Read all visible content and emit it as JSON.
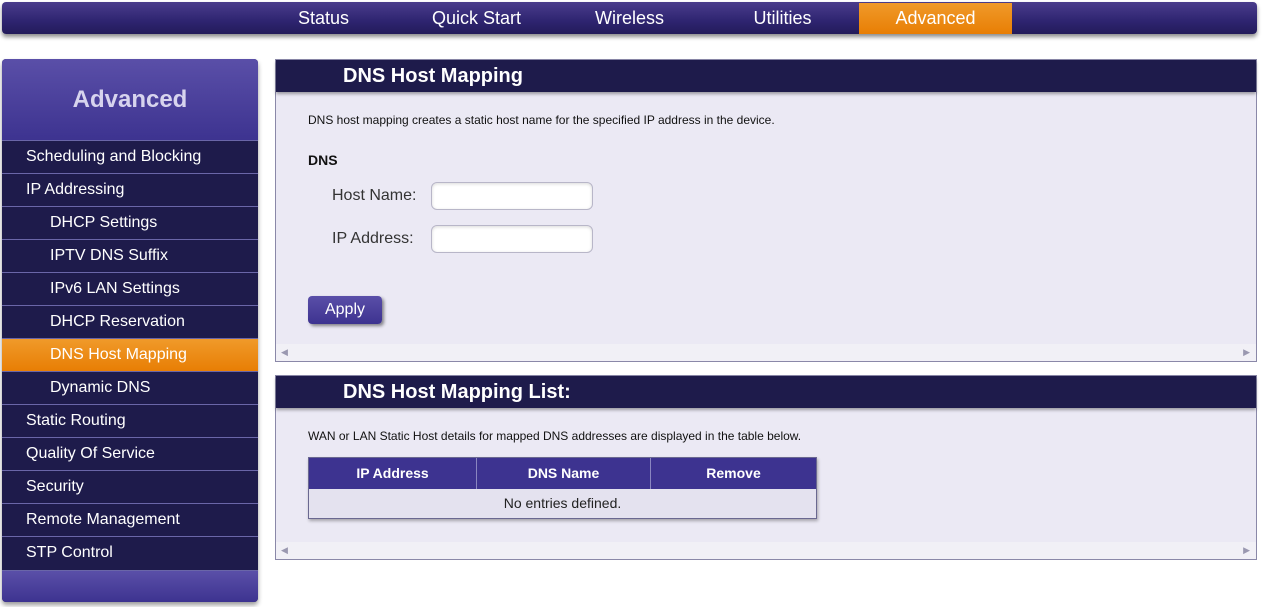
{
  "topnav": {
    "tabs": [
      {
        "label": "Status"
      },
      {
        "label": "Quick Start"
      },
      {
        "label": "Wireless"
      },
      {
        "label": "Utilities"
      },
      {
        "label": "Advanced",
        "active": true
      }
    ]
  },
  "sidebar": {
    "title": "Advanced",
    "items": [
      {
        "label": "Scheduling and Blocking"
      },
      {
        "label": "IP Addressing"
      },
      {
        "label": "DHCP Settings"
      },
      {
        "label": "IPTV DNS Suffix"
      },
      {
        "label": "IPv6 LAN Settings"
      },
      {
        "label": "DHCP Reservation"
      },
      {
        "label": "DNS Host Mapping",
        "active": true
      },
      {
        "label": "Dynamic DNS"
      },
      {
        "label": "Static Routing"
      },
      {
        "label": "Quality Of Service"
      },
      {
        "label": "Security"
      },
      {
        "label": "Remote Management"
      },
      {
        "label": "STP Control"
      }
    ]
  },
  "mapping": {
    "title": "DNS Host Mapping",
    "description": "DNS host mapping creates a static host name for the specified IP address in the device.",
    "section": "DNS",
    "host_name_label": "Host Name:",
    "host_name_value": "",
    "ip_address_label": "IP Address:",
    "ip_address_value": "",
    "apply_label": "Apply"
  },
  "list": {
    "title": "DNS Host Mapping List:",
    "description": "WAN or LAN Static Host details for mapped DNS addresses are displayed in the table below.",
    "columns": [
      "IP Address",
      "DNS Name",
      "Remove"
    ],
    "empty_text": "No entries defined."
  },
  "colors": {
    "nav_dark": "#1e1b4b",
    "nav_purple": "#3d3390",
    "accent_orange": "#e87e04",
    "panel_bg": "#ebe9f4"
  },
  "icons": {
    "scroll_left": "scroll-left-icon",
    "scroll_right": "scroll-right-icon"
  }
}
